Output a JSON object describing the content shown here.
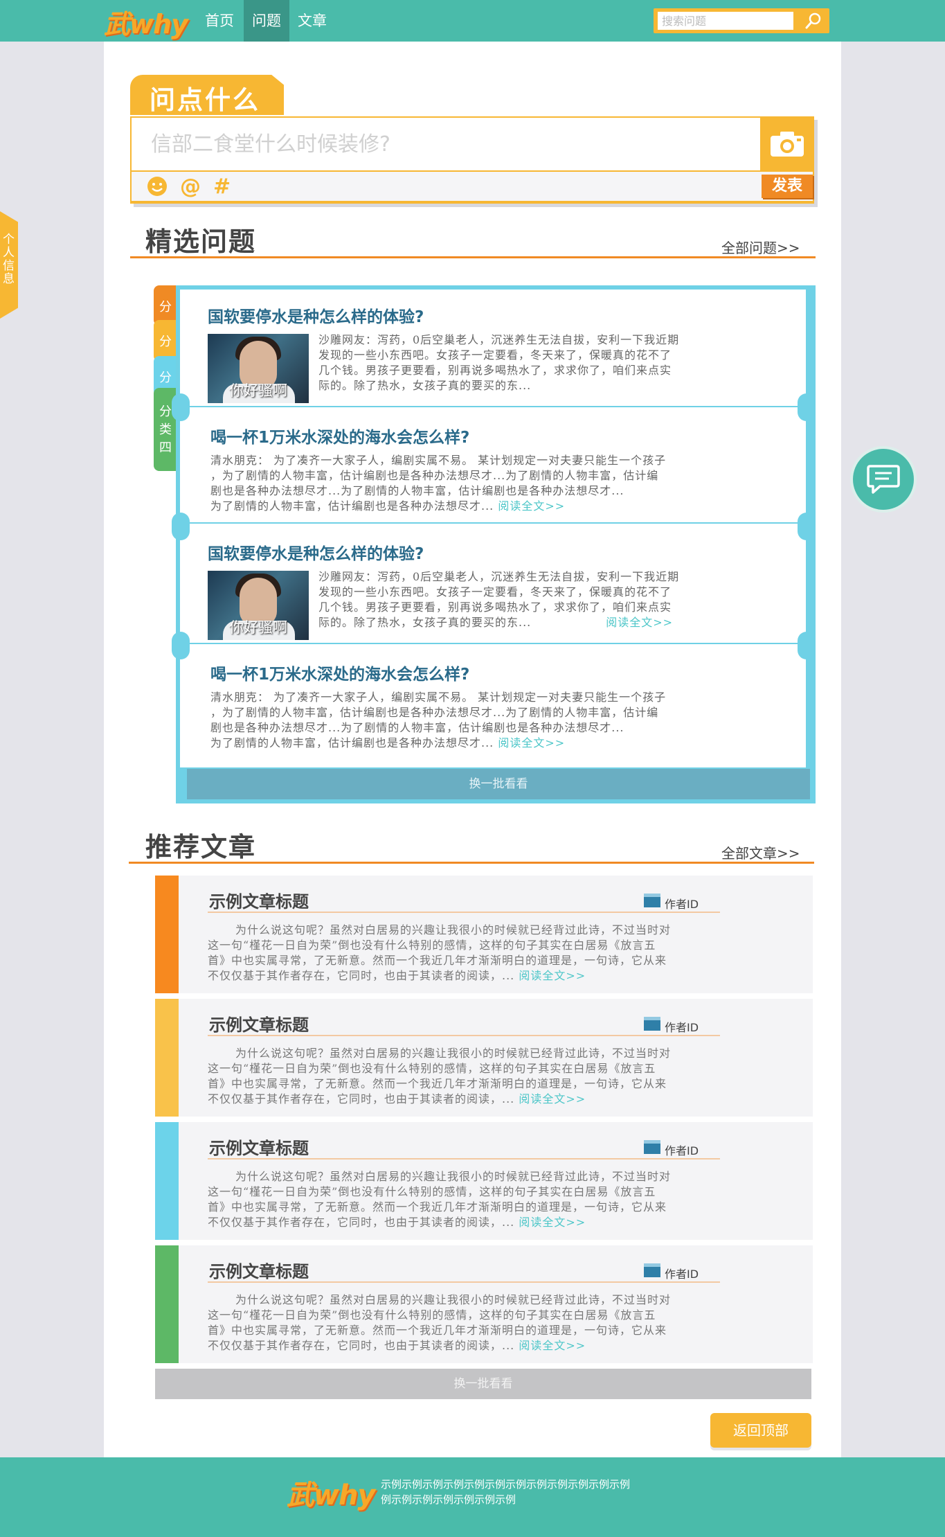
{
  "header": {
    "logo": "武why",
    "nav": [
      "首页",
      "问题",
      "文章"
    ],
    "active_nav": "问题",
    "search_placeholder": "搜索问题"
  },
  "ask": {
    "tab_title": "问点什么",
    "placeholder": "信部二食堂什么时候装修?",
    "tools": [
      "☻",
      "@",
      "#"
    ],
    "post_label": "发表"
  },
  "side_tab": "个人信息",
  "questions_section": {
    "title": "精选问题",
    "more": "全部问题>>",
    "categories": [
      "分",
      "分",
      "分",
      "分类四"
    ],
    "items": [
      {
        "title": "国软要停水是种怎么样的体验?",
        "has_image": true,
        "image_caption": "你好骚啊",
        "lines": [
          "沙雕网友：泻药，0后空巢老人，沉迷养生无法自拔，安利一下我近期",
          "发现的一些小东西吧。女孩子一定要看，冬天来了，保暖真的花不了",
          "几个钱。男孩子更要看，别再说多喝热水了，求求你了，咱们来点实",
          "际的。除了热水，女孩子真的要买的东..."
        ],
        "read_more": ""
      },
      {
        "title": "喝一杯1万米水深处的海水会怎么样?",
        "has_image": false,
        "lines": [
          "清水朋克： 为了凑齐一大家子人，编剧实属不易。 某计划规定一对夫妻只能生一个孩子",
          "，为了剧情的人物丰富，估计编剧也是各种办法想尽才...为了剧情的人物丰富，估计编",
          "剧也是各种办法想尽才...为了剧情的人物丰富，估计编剧也是各种办法想尽才...",
          "为了剧情的人物丰富，估计编剧也是各种办法想尽才..."
        ],
        "read_more": "阅读全文>>"
      },
      {
        "title": "国软要停水是种怎么样的体验?",
        "has_image": true,
        "image_caption": "你好骚啊",
        "lines": [
          "沙雕网友：泻药，0后空巢老人，沉迷养生无法自拔，安利一下我近期",
          "发现的一些小东西吧。女孩子一定要看，冬天来了，保暖真的花不了",
          "几个钱。男孩子更要看，别再说多喝热水了，求求你了，咱们来点实",
          "际的。除了热水，女孩子真的要买的东..."
        ],
        "read_more": "阅读全文>>"
      },
      {
        "title": "喝一杯1万米水深处的海水会怎么样?",
        "has_image": false,
        "lines": [
          "清水朋克： 为了凑齐一大家子人，编剧实属不易。 某计划规定一对夫妻只能生一个孩子",
          "，为了剧情的人物丰富，估计编剧也是各种办法想尽才...为了剧情的人物丰富，估计编",
          "剧也是各种办法想尽才...为了剧情的人物丰富，估计编剧也是各种办法想尽才...",
          "为了剧情的人物丰富，估计编剧也是各种办法想尽才..."
        ],
        "read_more": "阅读全文>>"
      }
    ],
    "refresh": "换一批看看"
  },
  "articles_section": {
    "title": "推荐文章",
    "more": "全部文章>>",
    "items": [
      {
        "title": "示例文章标题",
        "author": "作者ID",
        "color": "#f7891f",
        "lines": [
          "为什么说这句呢？虽然对白居易的兴趣让我很小的时候就已经背过此诗，不过当时对",
          "这一句“槿花一日自为荣”倒也没有什么特别的感情，这样的句子其实在白居易《放言五",
          "首》中也实属寻常，了无新意。然而一个我近几年才渐渐明白的道理是，一句诗，它从来",
          "不仅仅基于其作者存在，它同时，也由于其读者的阅读，..."
        ],
        "read_more": "阅读全文>>"
      },
      {
        "title": "示例文章标题",
        "author": "作者ID",
        "color": "#f9c24a",
        "lines": [
          "为什么说这句呢？虽然对白居易的兴趣让我很小的时候就已经背过此诗，不过当时对",
          "这一句“槿花一日自为荣”倒也没有什么特别的感情，这样的句子其实在白居易《放言五",
          "首》中也实属寻常，了无新意。然而一个我近几年才渐渐明白的道理是，一句诗，它从来",
          "不仅仅基于其作者存在，它同时，也由于其读者的阅读，..."
        ],
        "read_more": "阅读全文>>"
      },
      {
        "title": "示例文章标题",
        "author": "作者ID",
        "color": "#6cd3ea",
        "lines": [
          "为什么说这句呢？虽然对白居易的兴趣让我很小的时候就已经背过此诗，不过当时对",
          "这一句“槿花一日自为荣”倒也没有什么特别的感情，这样的句子其实在白居易《放言五",
          "首》中也实属寻常，了无新意。然而一个我近几年才渐渐明白的道理是，一句诗，它从来",
          "不仅仅基于其作者存在，它同时，也由于其读者的阅读，..."
        ],
        "read_more": "阅读全文>>"
      },
      {
        "title": "示例文章标题",
        "author": "作者ID",
        "color": "#5db866",
        "lines": [
          "为什么说这句呢？虽然对白居易的兴趣让我很小的时候就已经背过此诗，不过当时对",
          "这一句“槿花一日自为荣”倒也没有什么特别的感情，这样的句子其实在白居易《放言五",
          "首》中也实属寻常，了无新意。然而一个我近几年才渐渐明白的道理是，一句诗，它从来",
          "不仅仅基于其作者存在，它同时，也由于其读者的阅读，..."
        ],
        "read_more": "阅读全文>>"
      }
    ],
    "refresh": "换一批看看"
  },
  "back_to_top": "返回顶部",
  "footer": {
    "logo": "武why",
    "text_lines": [
      "示例示例示例示例示例示例示例示例示例示例示例示例",
      "例示例示例示例示例示例示例"
    ]
  }
}
